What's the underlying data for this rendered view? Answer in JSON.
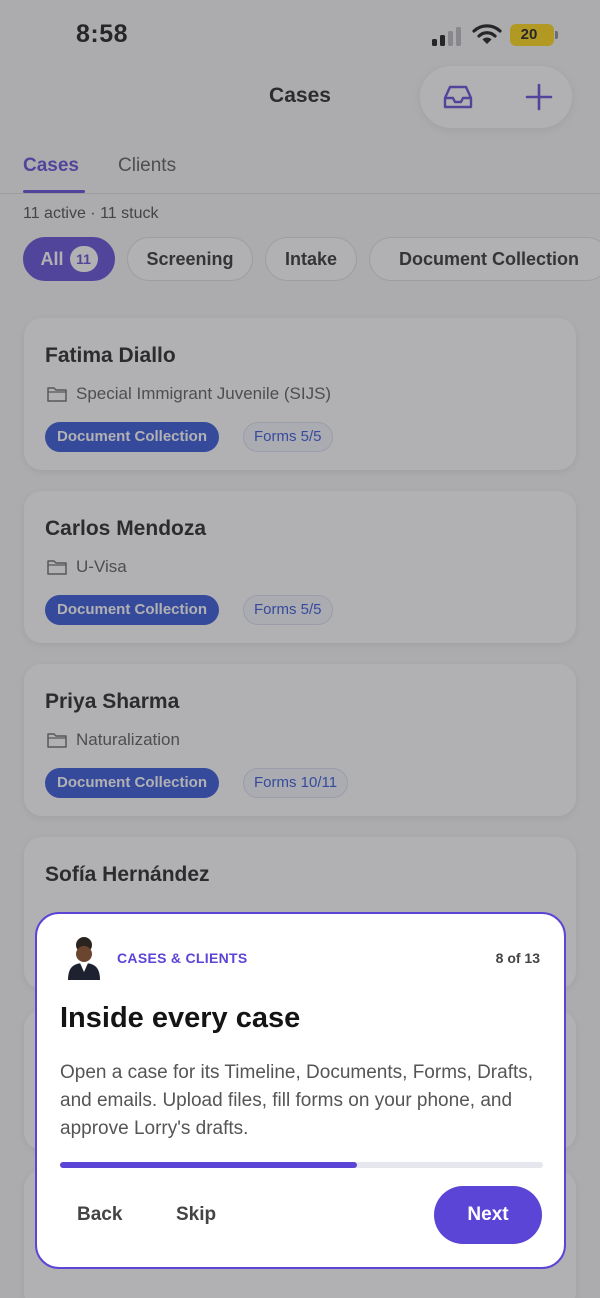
{
  "status_bar": {
    "time": "8:58",
    "battery": "20"
  },
  "header": {
    "title": "Cases"
  },
  "tabs": [
    {
      "label": "Cases"
    },
    {
      "label": "Clients"
    }
  ],
  "summary": "11 active · 11 stuck",
  "filters": [
    {
      "label": "All",
      "count": "11"
    },
    {
      "label": "Screening"
    },
    {
      "label": "Intake"
    },
    {
      "label": "Document Collection"
    }
  ],
  "cases": [
    {
      "name": "Fatima Diallo",
      "type": "Special Immigrant Juvenile (SIJS)",
      "stage": "Document Collection",
      "forms": "Forms 5/5"
    },
    {
      "name": "Carlos Mendoza",
      "type": "U-Visa",
      "stage": "Document Collection",
      "forms": "Forms 5/5"
    },
    {
      "name": "Priya Sharma",
      "type": "Naturalization",
      "stage": "Document Collection",
      "forms": "Forms 10/11"
    },
    {
      "name": "Sofía Hernández"
    }
  ],
  "tour": {
    "eyebrow": "CASES & CLIENTS",
    "step": "8 of 13",
    "title": "Inside every case",
    "body": "Open a case for its Timeline, Documents, Forms, Drafts, and emails. Upload files, fill forms on your phone, and approve Lorry's drafts.",
    "progress": 0.615,
    "back_label": "Back",
    "skip_label": "Skip",
    "next_label": "Next"
  },
  "colors": {
    "accent": "#5b45d6",
    "stage_badge": "#2c4fd6",
    "battery": "#ffd60a"
  }
}
